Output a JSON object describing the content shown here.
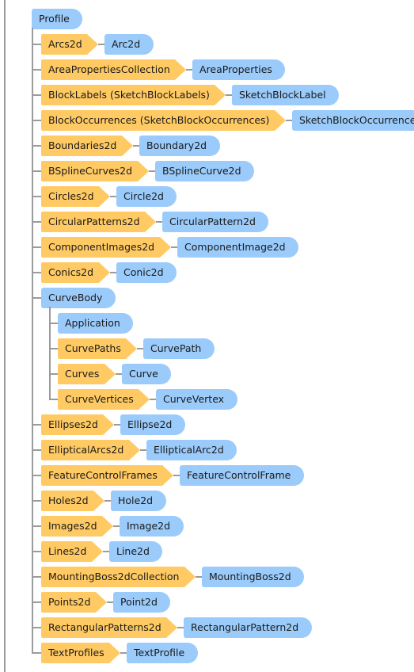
{
  "diagram": {
    "type": "object-model-tree",
    "colors": {
      "collection_fill": "#ffca63",
      "object_fill": "#9acbfb",
      "connector": "#9b9b9b",
      "text": "#1a1a1a",
      "background": "#ffffff"
    },
    "root": {
      "label": "Profile",
      "kind": "object"
    },
    "nodes": [
      {
        "level": 1,
        "collection": "Arcs2d",
        "object": "Arc2d"
      },
      {
        "level": 1,
        "collection": "AreaPropertiesCollection",
        "object": "AreaProperties"
      },
      {
        "level": 1,
        "collection": "BlockLabels (SketchBlockLabels)",
        "object": "SketchBlockLabel"
      },
      {
        "level": 1,
        "collection": "BlockOccurrences (SketchBlockOccurrences)",
        "object": "SketchBlockOccurrence"
      },
      {
        "level": 1,
        "collection": "Boundaries2d",
        "object": "Boundary2d"
      },
      {
        "level": 1,
        "collection": "BSplineCurves2d",
        "object": "BSplineCurve2d"
      },
      {
        "level": 1,
        "collection": "Circles2d",
        "object": "Circle2d"
      },
      {
        "level": 1,
        "collection": "CircularPatterns2d",
        "object": "CircularPattern2d"
      },
      {
        "level": 1,
        "collection": "ComponentImages2d",
        "object": "ComponentImage2d"
      },
      {
        "level": 1,
        "collection": "Conics2d",
        "object": "Conic2d"
      },
      {
        "level": 1,
        "collection": null,
        "object": "CurveBody"
      },
      {
        "level": 2,
        "collection": null,
        "object": "Application"
      },
      {
        "level": 2,
        "collection": "CurvePaths",
        "object": "CurvePath"
      },
      {
        "level": 2,
        "collection": "Curves",
        "object": "Curve"
      },
      {
        "level": 2,
        "collection": "CurveVertices",
        "object": "CurveVertex"
      },
      {
        "level": 1,
        "collection": "Ellipses2d",
        "object": "Ellipse2d"
      },
      {
        "level": 1,
        "collection": "EllipticalArcs2d",
        "object": "EllipticalArc2d"
      },
      {
        "level": 1,
        "collection": "FeatureControlFrames",
        "object": "FeatureControlFrame"
      },
      {
        "level": 1,
        "collection": "Holes2d",
        "object": "Hole2d"
      },
      {
        "level": 1,
        "collection": "Images2d",
        "object": "Image2d"
      },
      {
        "level": 1,
        "collection": "Lines2d",
        "object": "Line2d"
      },
      {
        "level": 1,
        "collection": "MountingBoss2dCollection",
        "object": "MountingBoss2d"
      },
      {
        "level": 1,
        "collection": "Points2d",
        "object": "Point2d"
      },
      {
        "level": 1,
        "collection": "RectangularPatterns2d",
        "object": "RectangularPattern2d"
      },
      {
        "level": 1,
        "collection": "TextProfiles",
        "object": "TextProfile"
      }
    ]
  }
}
